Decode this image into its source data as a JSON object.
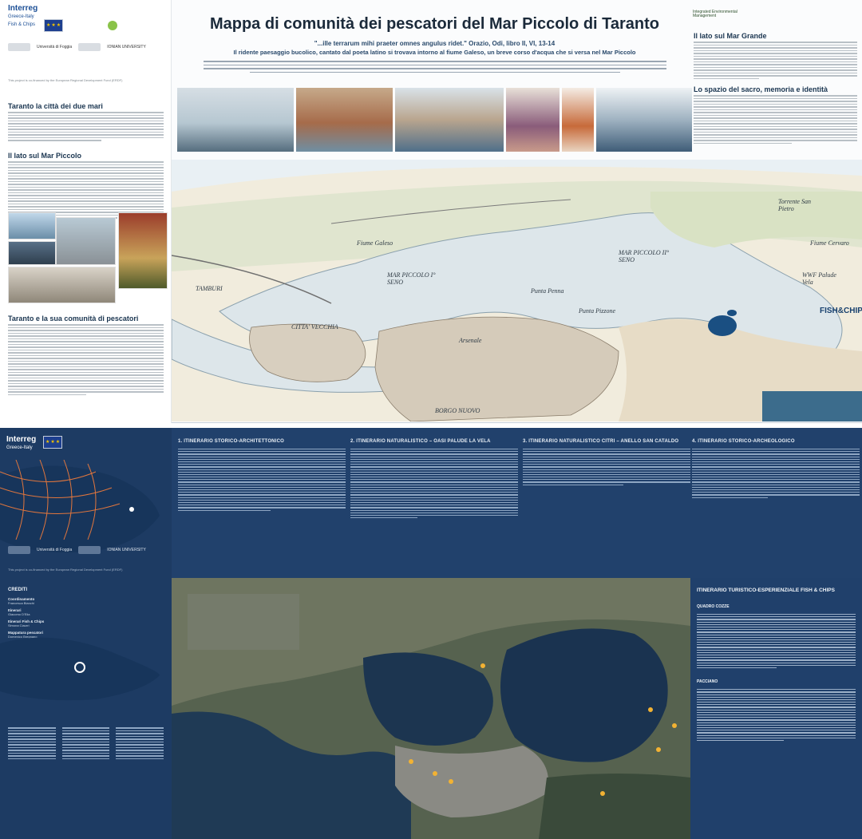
{
  "logos": {
    "program_name": "Interreg",
    "program_sub": "Greece-Italy",
    "program_tag": "Fish & Chips",
    "partner_iem": "Integrated Environmental Management",
    "partner_uni_foggia": "Università di Foggia",
    "partner_ionian": "IONIAN UNIVERSITY"
  },
  "top": {
    "title": "Mappa di comunità dei pescatori del Mar Piccolo di Taranto",
    "quote": "\"...ille terrarum mihi praeter omnes angulus ridet.\" Orazio, Odi, libro II, VI, 13-14",
    "sub_quote": "Il ridente paesaggio bucolico, cantato dal poeta latino si trovava intorno al fiume Galeso, un breve corso d'acqua che si versa nel Mar Piccolo",
    "funding_note": "This project is co-financed by the European Regional Development Fund (ERDF)",
    "left_sections": [
      {
        "title": "Taranto la città dei due mari"
      },
      {
        "title": "Il lato sul Mar Piccolo"
      },
      {
        "title": "Taranto e la sua comunità di pescatori"
      }
    ],
    "right_sections": [
      {
        "title": "Il lato sul Mar Grande"
      },
      {
        "title": "Lo spazio del sacro, memoria e identità"
      }
    ]
  },
  "map_labels": {
    "tamburi": "TAMBURI",
    "citta_vecchia": "CITTA' VECCHIA",
    "mar_piccolo_1": "MAR PICCOLO I° SENO",
    "mar_piccolo_2": "MAR PICCOLO II° SENO",
    "fiume_galeso": "Fiume Galeso",
    "borgo_nuovo": "BORGO NUOVO",
    "arsenale": "Arsenale",
    "punta_penna": "Punta Penna",
    "punta_pizzone": "Punta Pizzone",
    "wwf": "WWF Palude Vela",
    "torrente": "Torrente San Pietro",
    "fiume_cervaro": "Fiume Cervaro",
    "fish_chips": "FISH&CHIPS!"
  },
  "bottom": {
    "itineraries": [
      {
        "title": "1. ITINERARIO STORICO-ARCHITETTONICO"
      },
      {
        "title": "2. ITINERARIO NATURALISTICO – OASI PALUDE LA VELA"
      },
      {
        "title": "3. ITINERARIO NATURALISTICO CITRI – ANELLO SAN CATALDO"
      },
      {
        "title": "4. ITINERARIO STORICO-ARCHEOLOGICO"
      }
    ],
    "credits": {
      "title": "CREDITI",
      "groups": [
        {
          "head": "Coordinamento",
          "name": "Francesca Bianchi"
        },
        {
          "head": "Itinerari",
          "name": "Giacomo D'Elia"
        },
        {
          "head": "Itinerari Fish & Chips",
          "name": "Simona Ciaurri"
        },
        {
          "head": "Mappatura pescatori",
          "name": "Domenico Bregnano"
        },
        {
          "head": "Gruppo laboratorio",
          "name": "Cosimo Cimaglia"
        },
        {
          "head": "Illustrazioni",
          "name": "Loredana Magnone"
        },
        {
          "head": "Progettazione grafica",
          "name": "Fabio Ventaglieri"
        }
      ]
    },
    "right_panel": {
      "title": "ITINERARIO TURISTICO-ESPERIENZIALE FISH & CHIPS",
      "heads": [
        "QUADRO COZZE",
        "PACCIANO"
      ]
    }
  }
}
